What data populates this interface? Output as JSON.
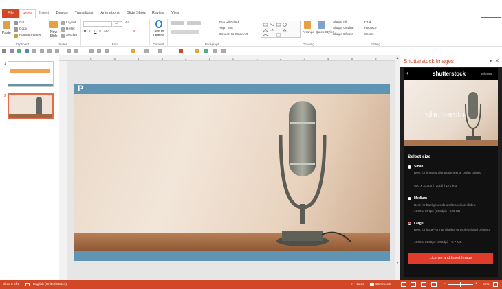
{
  "tabs": [
    "File",
    "Home",
    "Insert",
    "Design",
    "Transitions",
    "Animations",
    "Slide Show",
    "Review",
    "View"
  ],
  "ribbon": {
    "clipboard": {
      "paste": "Paste",
      "cut": "Cut",
      "copy": "Copy",
      "format_painter": "Format Painter",
      "label": "Clipboard"
    },
    "slides": {
      "new_slide": "New Slide",
      "layout": "Layout",
      "reset": "Reset",
      "section": "Section",
      "label": "Slides"
    },
    "font": {
      "size": "44",
      "label": "Font",
      "bold": "B",
      "italic": "I",
      "underline": "U",
      "strike": "S",
      "abc": "abc",
      "aa": "Aa",
      "case": "A"
    },
    "convert": {
      "text_to_outline": "Text to Outline",
      "label": "Convert"
    },
    "paragraph": {
      "text_direction": "Text Direction",
      "align_text": "Align Text",
      "smartart": "Convert to SmartArt",
      "label": "Paragraph"
    },
    "drawing": {
      "arrange": "Arrange",
      "quick_styles": "Quick Styles",
      "shape_fill": "Shape Fill",
      "shape_outline": "Shape Outline",
      "shape_effects": "Shape Effects",
      "label": "Drawing"
    },
    "editing": {
      "find": "Find",
      "replace": "Replace",
      "select": "Select",
      "label": "Editing"
    }
  },
  "slides": [
    {
      "number": "1"
    },
    {
      "number": "2"
    }
  ],
  "ruler_ticks": [
    "6",
    "5",
    "4",
    "3",
    "2",
    "1",
    "0",
    "1",
    "2",
    "3",
    "4",
    "5",
    "6"
  ],
  "slide_letter": "P",
  "panel": {
    "title": "Shutterstock Images",
    "brand": "shutterstock",
    "user": "Johanna",
    "preview_watermark": "shutterstock",
    "select_size": "Select size",
    "options": [
      {
        "name": "Small",
        "desc": "Best for images alongside text or bullet points.",
        "specs": "500 x 333px (72dpi)  |  171 KB",
        "selected": false
      },
      {
        "name": "Medium",
        "desc": "Best for backgrounds and transition slides.",
        "specs": "1000 x 667px (300dpi)  |  620 KB",
        "selected": false
      },
      {
        "name": "Large",
        "desc": "Best for large-format display or professional printing.",
        "specs": "4800 x 3200px (300dpi)  |  9.7 MB",
        "selected": true
      }
    ],
    "button": "License and Insert Image"
  },
  "status": {
    "slide": "Slide 2 of 2",
    "language": "English (United States)",
    "notes": "Notes",
    "comments": "Comments",
    "zoom": "85%"
  },
  "colors": {
    "accent": "#d24726",
    "button": "#e03c2b",
    "panel_bg": "#111111",
    "slide_blue": "#5f94b3"
  }
}
